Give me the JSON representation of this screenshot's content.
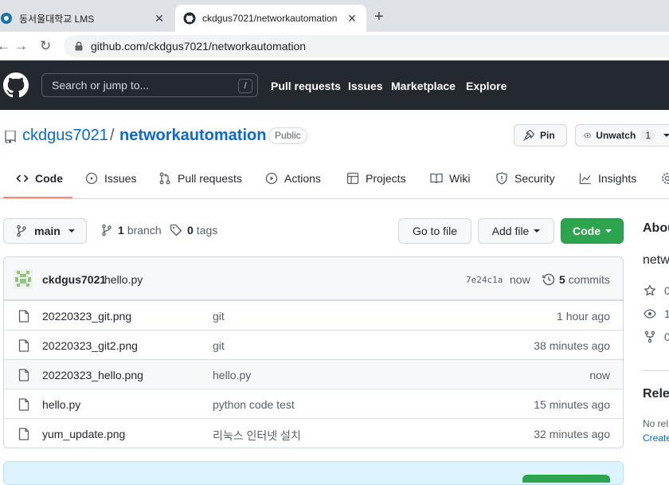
{
  "browser": {
    "tabs": [
      {
        "title": "동서울대학교 LMS",
        "close": "✕"
      },
      {
        "title": "ckdgus7021/networkautomation",
        "close": "✕"
      }
    ],
    "new_tab": "+",
    "url": "github.com/ckdgus7021/networkautomation"
  },
  "header": {
    "search_placeholder": "Search or jump to...",
    "search_shortcut": "/",
    "links": [
      "Pull requests",
      "Issues",
      "Marketplace",
      "Explore"
    ]
  },
  "repo": {
    "owner": "ckdgus7021",
    "separator": "/",
    "name": "networkautomation",
    "visibility": "Public",
    "pin_label": "Pin",
    "watch_label": "Unwatch",
    "watch_count": "1"
  },
  "repo_nav": {
    "tabs": [
      "Code",
      "Issues",
      "Pull requests",
      "Actions",
      "Projects",
      "Wiki",
      "Security",
      "Insights"
    ],
    "active": "Code"
  },
  "branch_bar": {
    "branch": "main",
    "branch_count": "1",
    "branch_label": "branch",
    "tag_count": "0",
    "tag_label": "tags",
    "go_to_file": "Go to file",
    "add_file": "Add file",
    "code": "Code"
  },
  "latest_commit": {
    "user": "ckdgus7021",
    "message": "hello.py",
    "sha": "7e24c1a",
    "time": "now",
    "count": "5",
    "count_label": "commits"
  },
  "files": [
    {
      "name": "20220323_git.png",
      "message": "git",
      "age": "1 hour ago"
    },
    {
      "name": "20220323_git2.png",
      "message": "git",
      "age": "38 minutes ago"
    },
    {
      "name": "20220323_hello.png",
      "message": "hello.py",
      "age": "now"
    },
    {
      "name": "hello.py",
      "message": "python code test",
      "age": "15 minutes ago"
    },
    {
      "name": "yum_update.png",
      "message": "리눅스 인터넷 설치",
      "age": "32 minutes ago"
    }
  ],
  "sidebar": {
    "about_title": "Abou",
    "description": "netw",
    "stats": [
      "0",
      "1",
      "0"
    ],
    "releases_title": "Relea",
    "releases_none": "No rel",
    "releases_create": "Create"
  },
  "colors": {
    "header_bg": "#24292f",
    "link": "#0969da",
    "green": "#2da44e",
    "active_tab_underline": "#fd8c73"
  }
}
